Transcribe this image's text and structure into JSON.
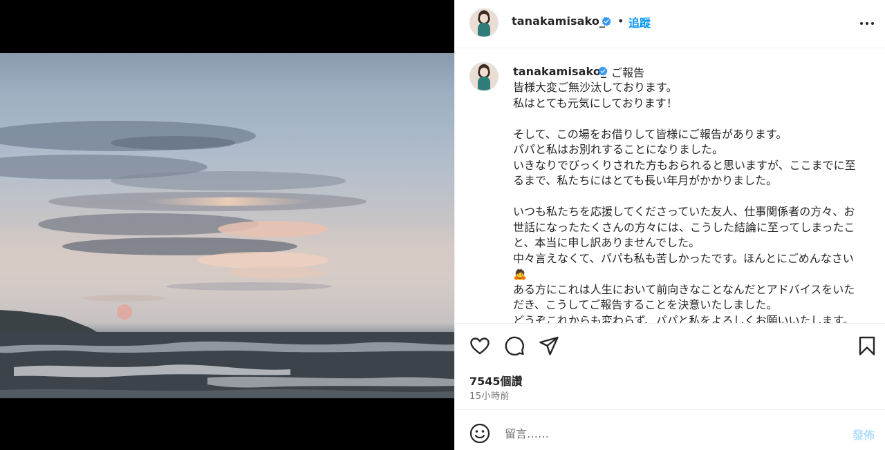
{
  "post": {
    "username": "tanakamisako_",
    "verified": true,
    "separator": "•",
    "follow_label": "追蹤",
    "caption_title": "ご報告",
    "caption_body": "皆様大変ご無沙汰しております。\n私はとても元気にしております！\n\nそして、この場をお借りして皆様にご報告があります。\nパパと私はお別れすることになりました。\nいきなりでびっくりされた方もおられると思いますが、ここまでに至るまで、私たちにはとても長い年月がかかりました。\n\nいつも私たちを応援してくださっていた友人、仕事関係者の方々、お世話になったたくさんの方々には、こうした結論に至ってしまったこと、本当に申し訳ありませんでした。\n中々言えなくて、パパも私も苦しかったです。ほんとにごめんなさい🙇\nある方にこれは人生において前向きなことなんだとアドバイスをいただき、こうしてご報告することを決意いたしました。\nどうぞこれからも変わらず、パパと私をよろしくお願いいたします。",
    "likes_text": "7545個讚",
    "timestamp": "15小時前"
  },
  "composer": {
    "placeholder": "留言……",
    "post_label": "發佈"
  },
  "icons": {
    "more": "more-horizontal-icon",
    "like": "heart-icon",
    "comment": "comment-bubble-icon",
    "share": "paper-plane-icon",
    "save": "bookmark-icon",
    "emoji": "smiley-icon",
    "verified": "verified-badge-icon"
  },
  "colors": {
    "link_blue": "#0095f6",
    "verified_blue": "#3897f0",
    "text_primary": "#262626",
    "text_secondary": "#737373",
    "post_disabled": "#b2dffc"
  }
}
